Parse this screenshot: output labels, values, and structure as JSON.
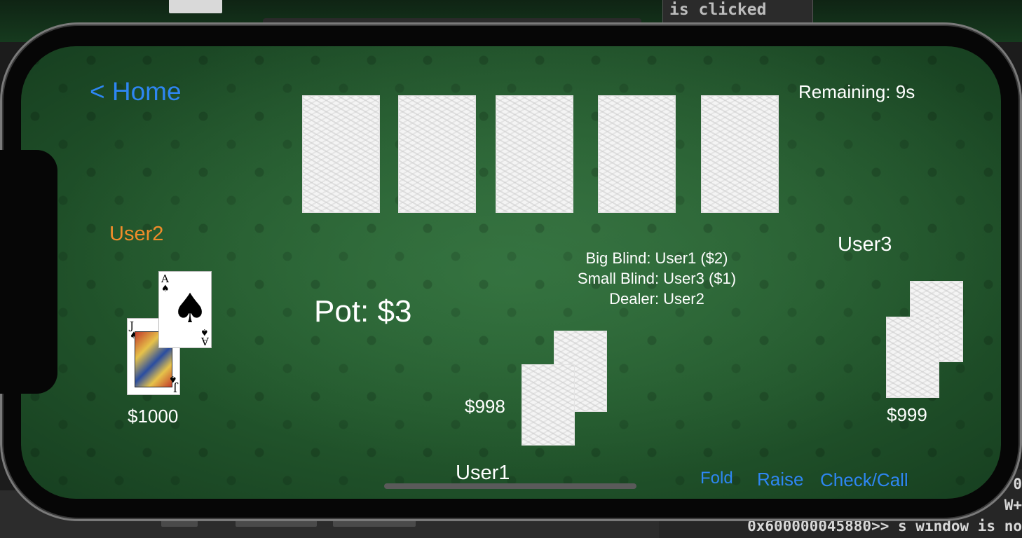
{
  "window": {
    "terminal_top_text": "is clicked",
    "terminal_bottom_lines": [
      "0",
      "W+",
      "0x600000045880>> s window is no"
    ]
  },
  "game": {
    "home_label": "< Home",
    "remaining_text": "Remaining: 9s",
    "pot_text": "Pot: $3",
    "blind_info": [
      "Big Blind: User1 ($2)",
      "Small Blind: User3 ($1)",
      "Dealer: User2"
    ],
    "community_cards": [
      {
        "state": "face-down"
      },
      {
        "state": "face-down"
      },
      {
        "state": "face-down"
      },
      {
        "state": "face-down"
      },
      {
        "state": "face-down"
      }
    ]
  },
  "players": {
    "user2": {
      "name": "User2",
      "money": "$1000",
      "name_color": "#f08c2a",
      "cards": [
        {
          "rank": "J",
          "suit": "♠"
        },
        {
          "rank": "A",
          "suit": "♠"
        }
      ]
    },
    "user1": {
      "name": "User1",
      "money": "$998"
    },
    "user3": {
      "name": "User3",
      "money": "$999"
    }
  },
  "actions": {
    "fold_label": "Fold",
    "raise_label": "Raise",
    "check_call_label": "Check/Call"
  },
  "colors": {
    "felt": "#245a2e",
    "link_blue": "#2e86f2",
    "active_player": "#f08c2a"
  }
}
